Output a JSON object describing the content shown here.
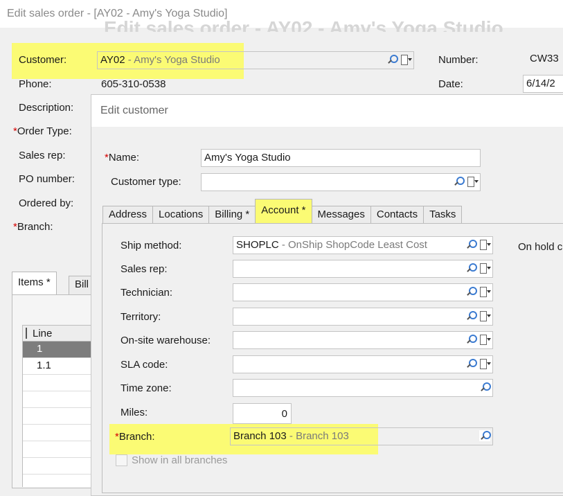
{
  "window": {
    "title": "Edit sales order - [AY02 - Amy's Yoga Studio]",
    "ghost_title": "Edit sales order - AY02 - Amy's Yoga Studio"
  },
  "order": {
    "customer_label": "Customer:",
    "customer_code": "AY02",
    "customer_name": " - Amy's Yoga Studio",
    "phone_label": "Phone:",
    "phone_value": "605-310-0538",
    "description_label": "Description:",
    "order_type_label": "Order Type:",
    "sales_rep_label": "Sales rep:",
    "po_number_label": "PO number:",
    "ordered_by_label": "Ordered by:",
    "branch_label": "Branch:",
    "required_mark": "*",
    "number_label": "Number:",
    "number_value": "CW33",
    "date_label": "Date:",
    "date_value": "6/14/2"
  },
  "order_tabs": {
    "items": "Items *",
    "billing": "Bill"
  },
  "grid": {
    "header_line": "Line",
    "rows": [
      "1",
      "1.1"
    ]
  },
  "dialog": {
    "title": "Edit customer",
    "name_label": "Name:",
    "name_value": "Amy's Yoga Studio",
    "customer_type_label": "Customer type:",
    "customer_type_value": "",
    "tabs": [
      "Address",
      "Locations",
      "Billing *",
      "Account *",
      "Messages",
      "Contacts",
      "Tasks"
    ],
    "account": {
      "ship_method_label": "Ship method:",
      "ship_method_code": "SHOPLC",
      "ship_method_desc": " - OnShip ShopCode Least Cost",
      "sales_rep_label": "Sales rep:",
      "technician_label": "Technician:",
      "territory_label": "Territory:",
      "onsite_warehouse_label": "On-site warehouse:",
      "sla_code_label": "SLA code:",
      "time_zone_label": "Time zone:",
      "miles_label": "Miles:",
      "miles_value": "0",
      "branch_label": "Branch:",
      "branch_code": "Branch 103",
      "branch_desc": " - Branch 103",
      "show_all_branches_label": "Show in all branches",
      "on_hold_label": "On hold c"
    }
  },
  "colors": {
    "highlight": "#fbfb74",
    "required": "#d40000",
    "selected_row": "#7d7d7d"
  },
  "icons": [
    "search-icon",
    "lookup-menu-icon"
  ]
}
